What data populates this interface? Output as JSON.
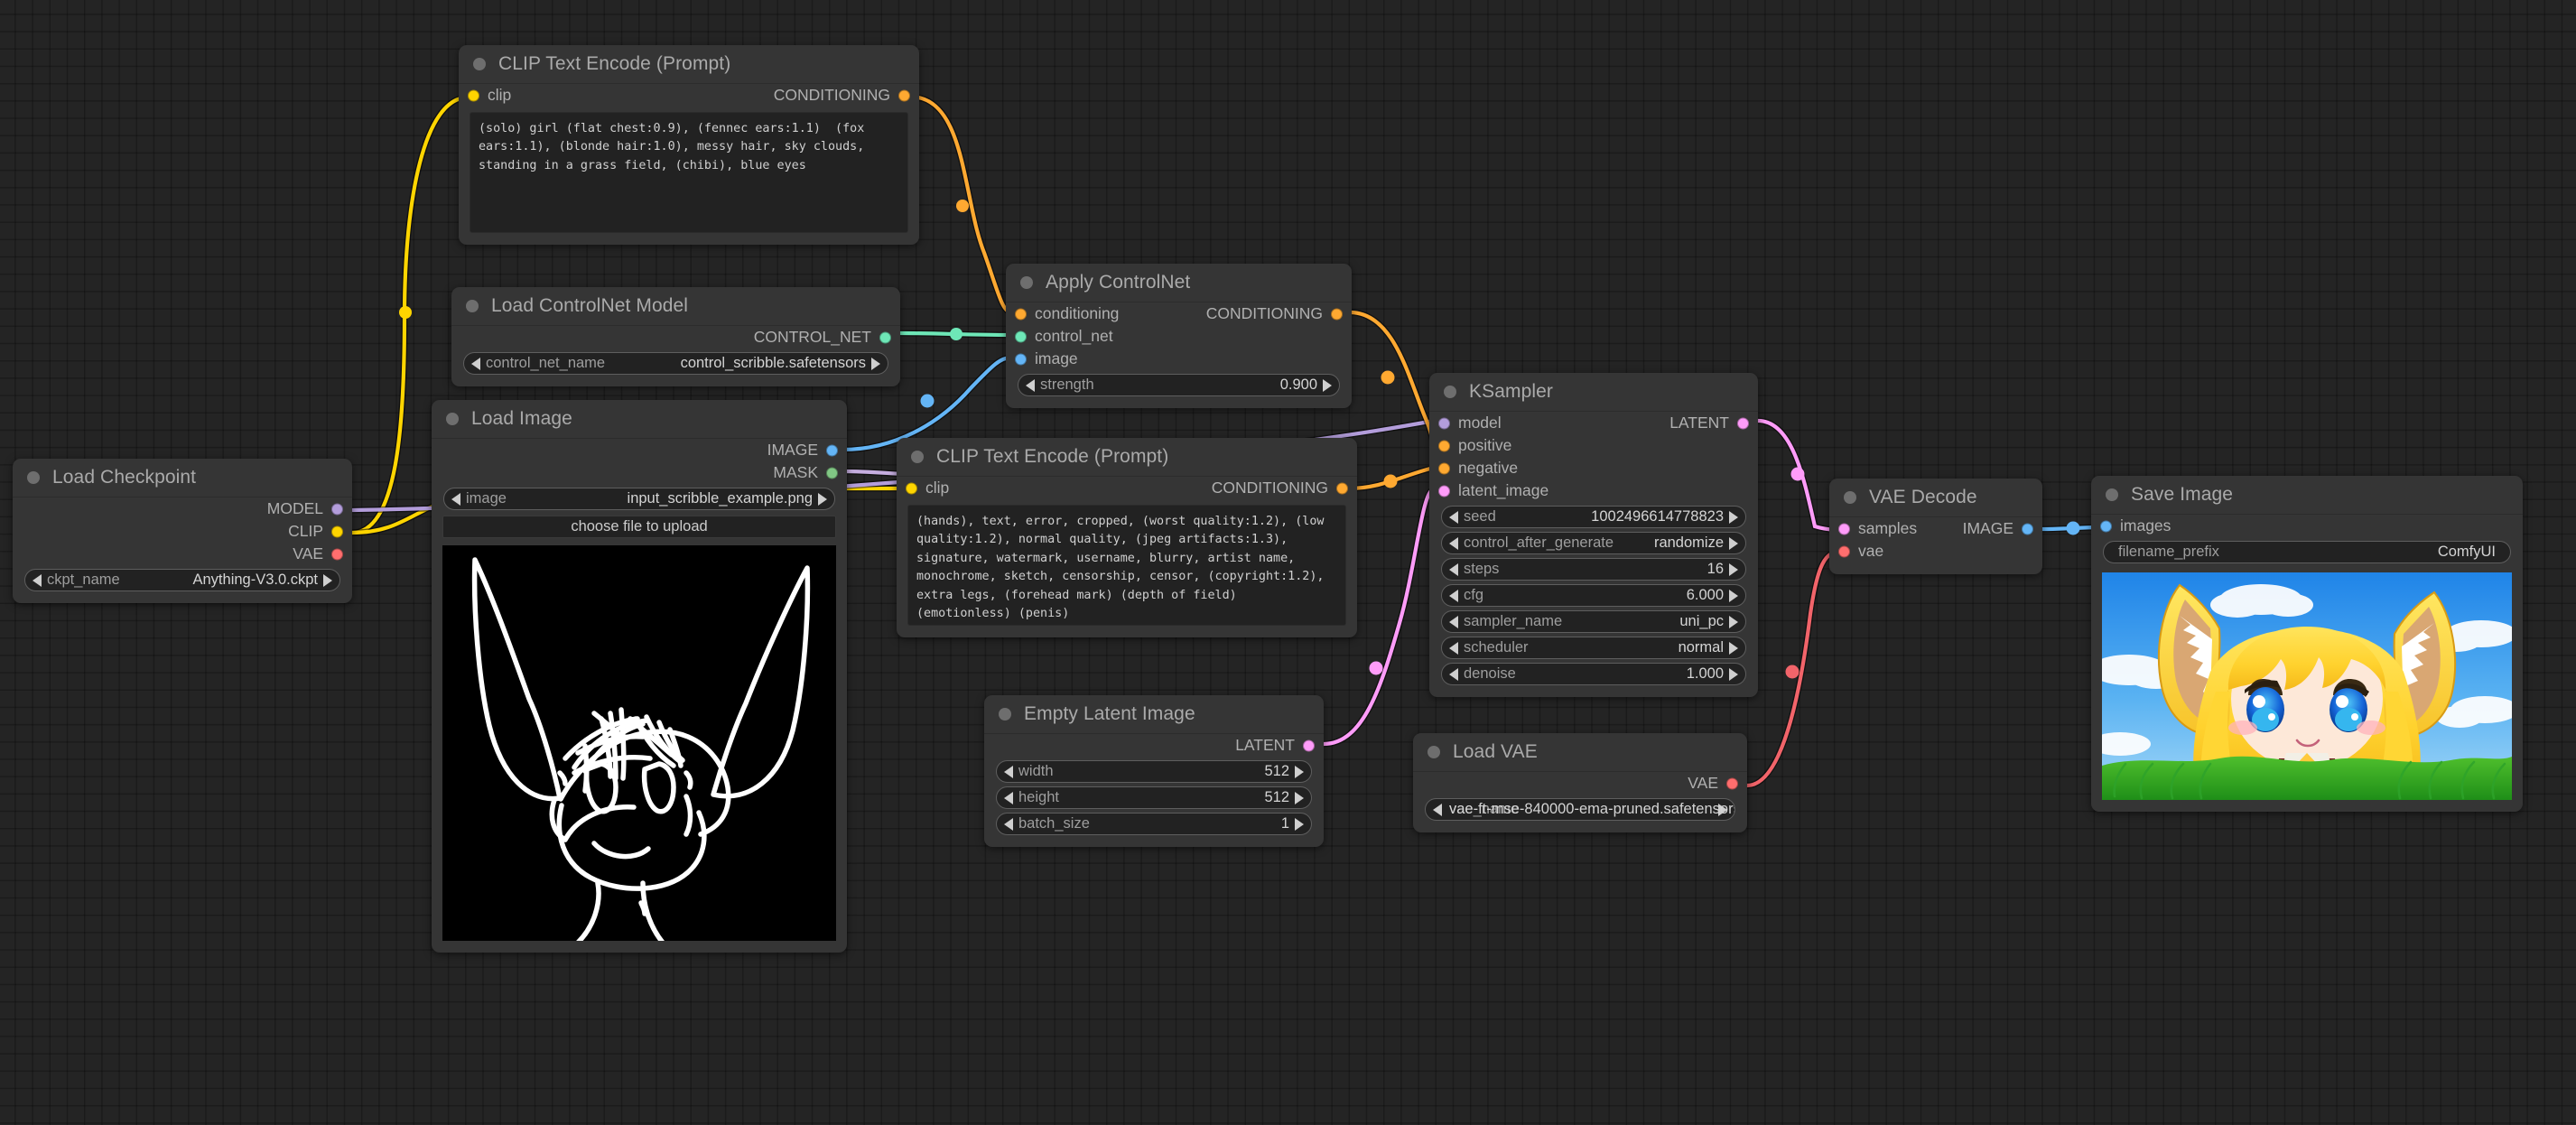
{
  "app": {
    "name": "ComfyUI",
    "canvas_bg": "#242424",
    "node_bg": "#353535",
    "node_title_bg": "#3b3b3b"
  },
  "slot_colors": {
    "MODEL": "#b39ddb",
    "CLIP": "#ffd500",
    "VAE": "#ff6e6e",
    "CONDITIONING": "#ffa931",
    "LATENT": "#ff9cf9",
    "IMAGE": "#64b5f6",
    "MASK": "#81c784",
    "CONTROL_NET": "#6ee7b7"
  },
  "nodes": [
    {
      "id": "load_checkpoint",
      "title": "Load Checkpoint",
      "outputs": [
        {
          "label": "MODEL",
          "type": "MODEL"
        },
        {
          "label": "CLIP",
          "type": "CLIP"
        },
        {
          "label": "VAE",
          "type": "VAE"
        }
      ],
      "widgets": [
        {
          "name": "ckpt_name",
          "value": "Anything-V3.0.ckpt"
        }
      ]
    },
    {
      "id": "clip_text_encode_positive",
      "title": "CLIP Text Encode (Prompt)",
      "inputs": [
        {
          "label": "clip",
          "type": "CLIP"
        }
      ],
      "outputs": [
        {
          "label": "CONDITIONING",
          "type": "CONDITIONING"
        }
      ],
      "text": "(solo) girl (flat chest:0.9), (fennec ears:1.1)  (fox ears:1.1), (blonde hair:1.0), messy hair, sky clouds, standing in a grass field, (chibi), blue eyes"
    },
    {
      "id": "load_controlnet_model",
      "title": "Load ControlNet Model",
      "outputs": [
        {
          "label": "CONTROL_NET",
          "type": "CONTROL_NET"
        }
      ],
      "widgets": [
        {
          "name": "control_net_name",
          "value": "control_scribble.safetensors"
        }
      ]
    },
    {
      "id": "load_image",
      "title": "Load Image",
      "outputs": [
        {
          "label": "IMAGE",
          "type": "IMAGE"
        },
        {
          "label": "MASK",
          "type": "MASK"
        }
      ],
      "widgets": [
        {
          "name": "image",
          "value": "input_scribble_example.png"
        }
      ],
      "upload_button": "choose file to upload",
      "preview": "scribble-drawing"
    },
    {
      "id": "apply_controlnet",
      "title": "Apply ControlNet",
      "inputs": [
        {
          "label": "conditioning",
          "type": "CONDITIONING"
        },
        {
          "label": "control_net",
          "type": "CONTROL_NET"
        },
        {
          "label": "image",
          "type": "IMAGE"
        }
      ],
      "outputs": [
        {
          "label": "CONDITIONING",
          "type": "CONDITIONING"
        }
      ],
      "widgets": [
        {
          "name": "strength",
          "value": "0.900"
        }
      ]
    },
    {
      "id": "clip_text_encode_negative",
      "title": "CLIP Text Encode (Prompt)",
      "inputs": [
        {
          "label": "clip",
          "type": "CLIP"
        }
      ],
      "outputs": [
        {
          "label": "CONDITIONING",
          "type": "CONDITIONING"
        }
      ],
      "text": "(hands), text, error, cropped, (worst quality:1.2), (low quality:1.2), normal quality, (jpeg artifacts:1.3), signature, watermark, username, blurry, artist name, monochrome, sketch, censorship, censor, (copyright:1.2), extra legs, (forehead mark) (depth of field) (emotionless) (penis)"
    },
    {
      "id": "ksampler",
      "title": "KSampler",
      "inputs": [
        {
          "label": "model",
          "type": "MODEL"
        },
        {
          "label": "positive",
          "type": "CONDITIONING"
        },
        {
          "label": "negative",
          "type": "CONDITIONING"
        },
        {
          "label": "latent_image",
          "type": "LATENT"
        }
      ],
      "outputs": [
        {
          "label": "LATENT",
          "type": "LATENT"
        }
      ],
      "widgets": [
        {
          "name": "seed",
          "value": "1002496614778823"
        },
        {
          "name": "control_after_generate",
          "value": "randomize"
        },
        {
          "name": "steps",
          "value": "16"
        },
        {
          "name": "cfg",
          "value": "6.000"
        },
        {
          "name": "sampler_name",
          "value": "uni_pc"
        },
        {
          "name": "scheduler",
          "value": "normal"
        },
        {
          "name": "denoise",
          "value": "1.000"
        }
      ]
    },
    {
      "id": "empty_latent_image",
      "title": "Empty Latent Image",
      "outputs": [
        {
          "label": "LATENT",
          "type": "LATENT"
        }
      ],
      "widgets": [
        {
          "name": "width",
          "value": "512"
        },
        {
          "name": "height",
          "value": "512"
        },
        {
          "name": "batch_size",
          "value": "1"
        }
      ]
    },
    {
      "id": "load_vae",
      "title": "Load VAE",
      "outputs": [
        {
          "label": "VAE",
          "type": "VAE"
        }
      ],
      "widgets": [
        {
          "name": "vae_name",
          "value": "vae-ft-mse-840000-ema-pruned.safetensors"
        }
      ]
    },
    {
      "id": "vae_decode",
      "title": "VAE Decode",
      "inputs": [
        {
          "label": "samples",
          "type": "LATENT"
        },
        {
          "label": "vae",
          "type": "VAE"
        }
      ],
      "outputs": [
        {
          "label": "IMAGE",
          "type": "IMAGE"
        }
      ]
    },
    {
      "id": "save_image",
      "title": "Save Image",
      "inputs": [
        {
          "label": "images",
          "type": "IMAGE"
        }
      ],
      "widgets": [
        {
          "name": "filename_prefix",
          "value": "ComfyUI"
        }
      ],
      "preview": "chibi-fennec-girl"
    }
  ]
}
